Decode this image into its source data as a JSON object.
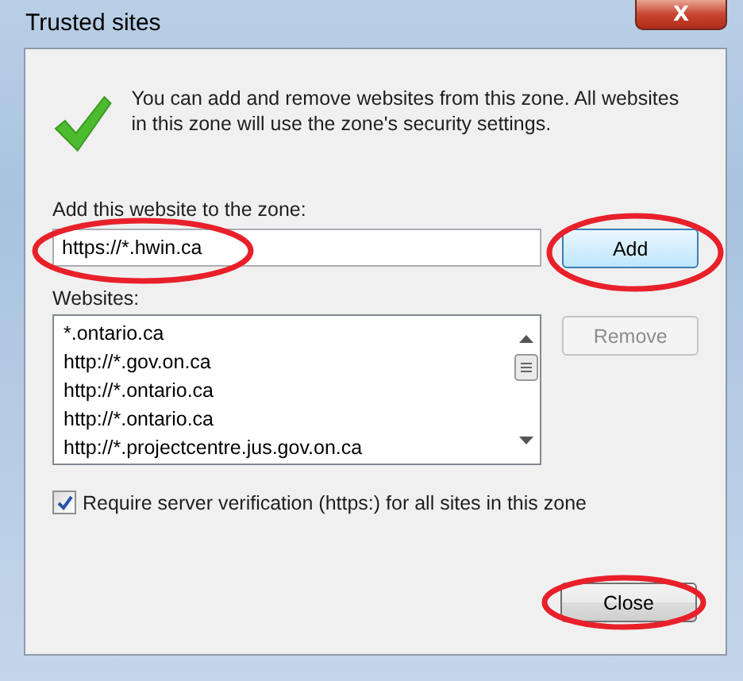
{
  "window": {
    "title": "Trusted sites",
    "close_label": "X"
  },
  "info": "You can add and remove websites from this zone. All websites in this zone will use the zone's security settings.",
  "add_field": {
    "label": "Add this website to the zone:",
    "value": "https://*.hwin.ca",
    "highlighted": true
  },
  "add_button": {
    "label": "Add",
    "disabled": false,
    "highlighted": true
  },
  "websites": {
    "label": "Websites:",
    "items": [
      {
        "text": "*.ontario.ca"
      },
      {
        "text": "http://*.gov.on.ca"
      },
      {
        "text": "http://*.ontario.ca"
      },
      {
        "text": "http://*.ontario.ca"
      },
      {
        "text": "http://*.projectcentre.jus.gov.on.ca"
      }
    ]
  },
  "remove_button": {
    "label": "Remove",
    "disabled": true
  },
  "require_https": {
    "label": "Require server verification (https:) for all sites in this zone",
    "checked": true
  },
  "close_button": {
    "label": "Close",
    "disabled": false,
    "highlighted": true
  }
}
